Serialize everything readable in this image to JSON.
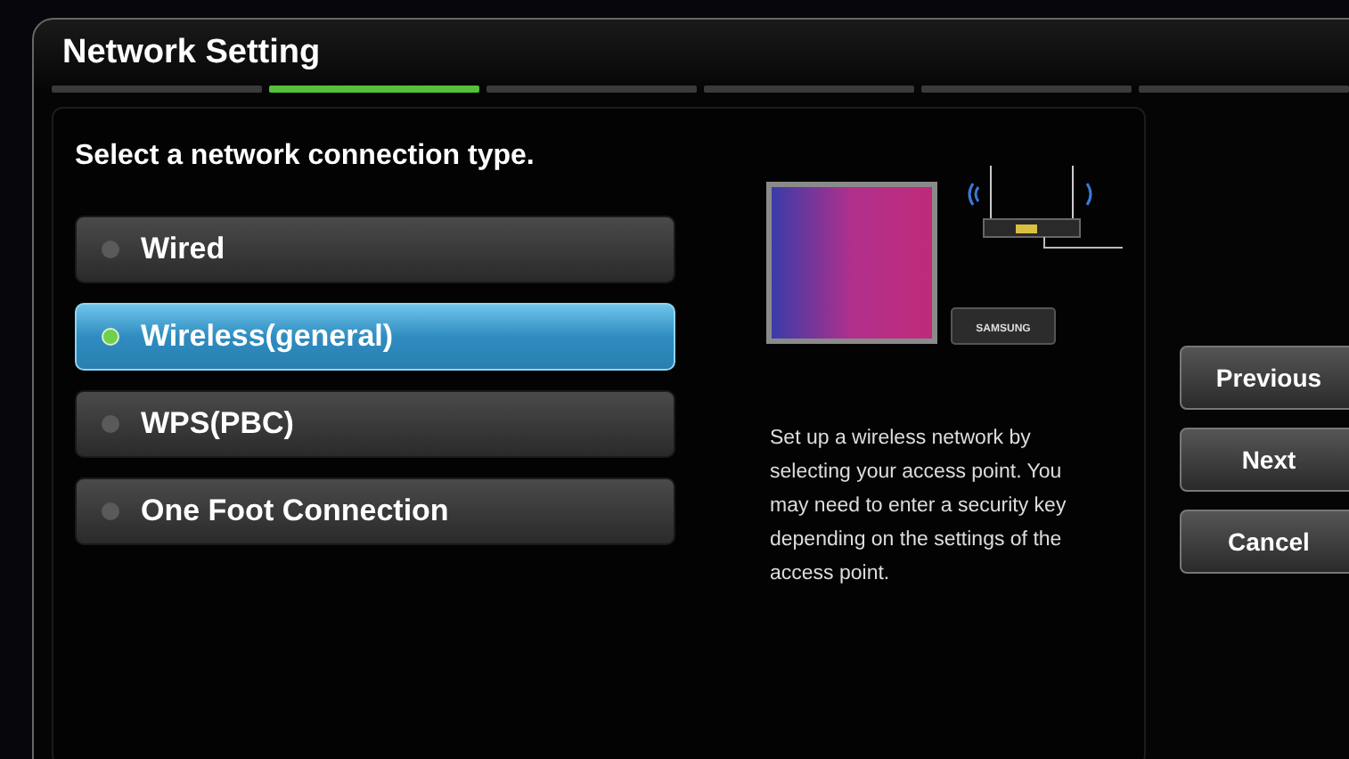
{
  "window": {
    "title": "Network Setting"
  },
  "steps": [
    {
      "selected": false
    },
    {
      "selected": true
    },
    {
      "selected": false
    },
    {
      "selected": false
    },
    {
      "selected": false
    },
    {
      "selected": false
    }
  ],
  "prompt": "Select a network connection type.",
  "options": [
    {
      "label": "Wired",
      "selected": false
    },
    {
      "label": "Wireless(general)",
      "selected": true
    },
    {
      "label": "WPS(PBC)",
      "selected": false
    },
    {
      "label": "One Foot Connection",
      "selected": false
    }
  ],
  "illustration": {
    "adapter_label": "SAMSUNG"
  },
  "description": "Set up a wireless network by selecting your access point. You may need to enter a security key depending on the settings of the access point.",
  "buttons": [
    "Previous",
    "Next",
    "Cancel"
  ]
}
